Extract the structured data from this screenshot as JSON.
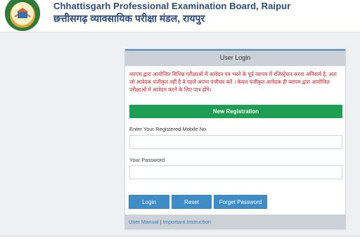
{
  "header": {
    "org_name_english": "Chhattisgarh Professional Examination Board, Raipur",
    "org_name_hindi": "छत्तीसगढ़ व्यावसायिक परीक्षा मंडल, रायपुर",
    "logo_icon": "cgvyapam-emblem-icon"
  },
  "login": {
    "title": "User Login",
    "notice": "व्यापम द्वारा आयोजित विभिन्न परीक्षाओं में आवेदन पत्र भरने के पूर्व व्यापम में रजिस्ट्रेशन करना अनिवार्य है, अतः जो आवेदक पंजीकृत नहीं है वे पहले अपना पंजीयन करें । केवल पंजीकृत आवेदक ही व्यापम द्वारा आयोजित परीक्षाओं में आवेदन करने के लिए पात्र होंगे।",
    "new_registration_label": "New Registration",
    "mobile_label": "Enter Your Registered Mobile No",
    "mobile_value": "",
    "password_label": "Your Password",
    "password_value": "",
    "login_button": "Login",
    "reset_button": "Reset",
    "forgot_button": "Forget Password",
    "user_manual_link": "User Manual",
    "separator": "|",
    "instruction_link": "Important Instruction"
  },
  "colors": {
    "notice_text": "#d0171e",
    "register_button": "#1e9e52",
    "action_button": "#3f8dc6",
    "link": "#3a77b8"
  }
}
